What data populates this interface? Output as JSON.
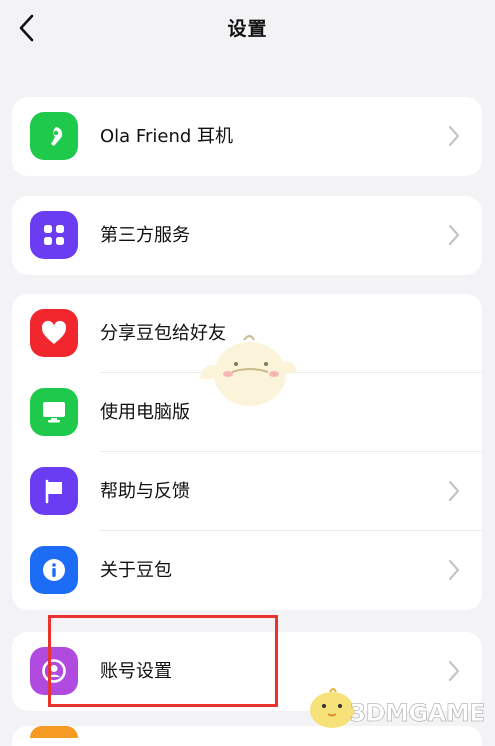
{
  "header": {
    "title": "设置"
  },
  "colors": {
    "ola_friend": "#1ec94b",
    "third_party": "#6a3df2",
    "share": "#f2262d",
    "desktop": "#1ec94b",
    "help": "#6a3df2",
    "about": "#1c6cf5",
    "account": "#b14be0",
    "highlight": "#e8332e"
  },
  "groups": [
    {
      "items": [
        {
          "label": "Ola Friend 耳机",
          "icon": "earbud-icon",
          "has_chevron": true
        }
      ]
    },
    {
      "items": [
        {
          "label": "第三方服务",
          "icon": "grid-icon",
          "has_chevron": true
        }
      ]
    },
    {
      "items": [
        {
          "label": "分享豆包给好友",
          "icon": "heart-icon",
          "has_chevron": false
        },
        {
          "label": "使用电脑版",
          "icon": "monitor-icon",
          "has_chevron": false
        },
        {
          "label": "帮助与反馈",
          "icon": "flag-icon",
          "has_chevron": true
        },
        {
          "label": "关于豆包",
          "icon": "info-icon",
          "has_chevron": true
        }
      ]
    },
    {
      "items": [
        {
          "label": "账号设置",
          "icon": "account-icon",
          "has_chevron": true
        }
      ]
    }
  ],
  "watermark": {
    "text": "3DMGAME"
  }
}
